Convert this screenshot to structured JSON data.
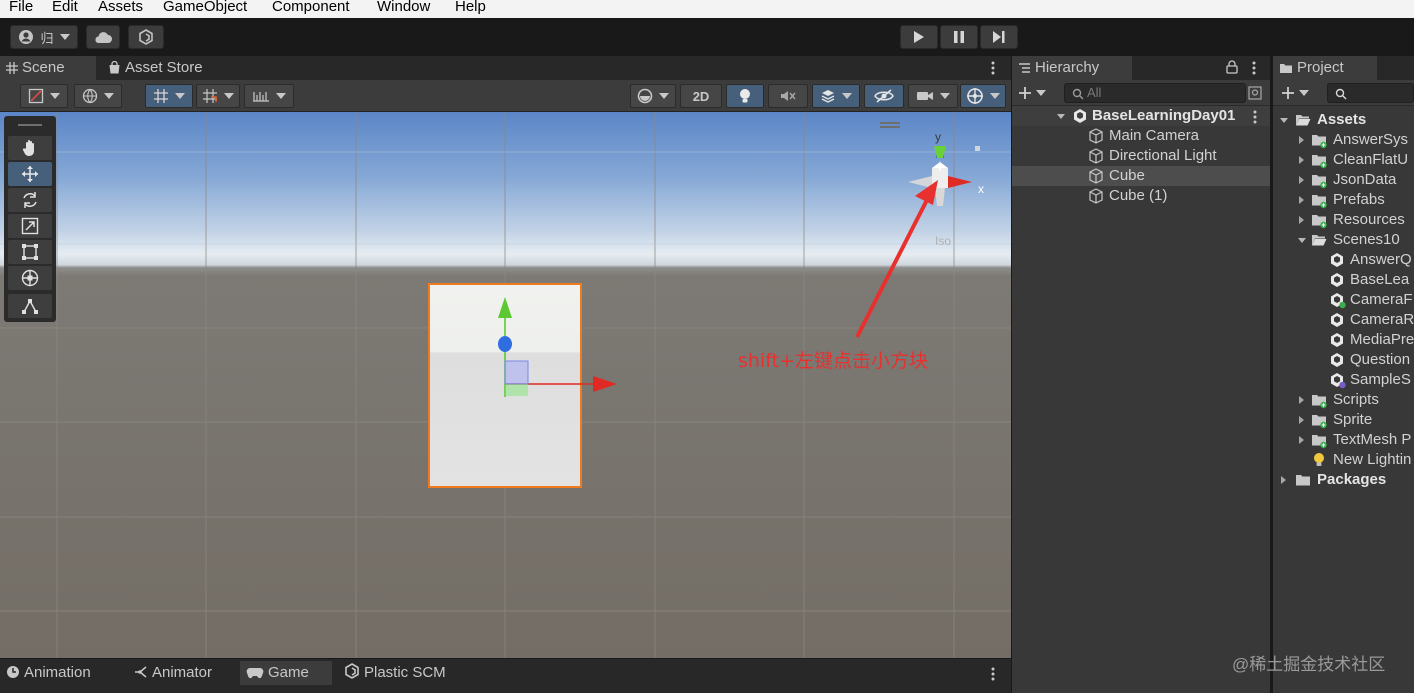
{
  "menu": [
    "File",
    "Edit",
    "Assets",
    "GameObject",
    "Component",
    "Window",
    "Help"
  ],
  "account": {
    "label": "归"
  },
  "scene_tabs": [
    "Scene",
    "Asset Store"
  ],
  "scene_toolbar": {
    "mode_2d": "2D"
  },
  "gizmo": {
    "y_label": "y",
    "x_label": "x",
    "persp_label": "Iso"
  },
  "annotation": "shift+左键点击小方块",
  "bottom_tabs": [
    "Animation",
    "Animator",
    "Game",
    "Plastic SCM"
  ],
  "hierarchy": {
    "title": "Hierarchy",
    "search_placeholder": "All",
    "scene_name": "BaseLearningDay01",
    "items": [
      "Main Camera",
      "Directional Light",
      "Cube",
      "Cube (1)"
    ],
    "selected": "Cube"
  },
  "project": {
    "title": "Project",
    "assets_label": "Assets",
    "folders": [
      "AnswerSys",
      "CleanFlatU",
      "JsonData",
      "Prefabs",
      "Resources"
    ],
    "scenes_folder": "Scenes10",
    "scenes": [
      "AnswerQ",
      "BaseLea",
      "CameraF",
      "CameraR",
      "MediaPre",
      "Question",
      "SampleS"
    ],
    "more_folders": [
      "Scripts",
      "Sprite",
      "TextMesh P"
    ],
    "lighting": "New Lightin",
    "packages_label": "Packages"
  },
  "watermark": "@稀土掘金技术社区",
  "colors": {
    "accent_blue": "#46607c",
    "selection_outline": "#f07a1e",
    "axis_red": "#e02a24",
    "axis_green": "#5cc832",
    "axis_blue": "#2f6ee0",
    "annotation_red": "#e8302e"
  }
}
